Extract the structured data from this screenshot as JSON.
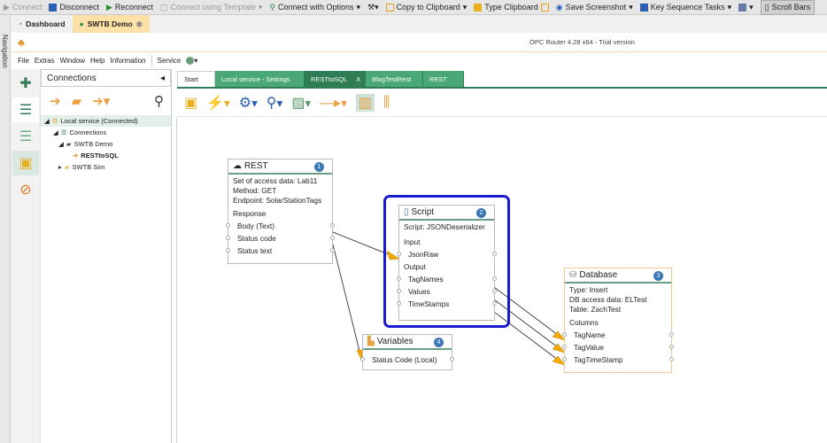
{
  "toolbar": {
    "connect": "Connect",
    "disconnect": "Disconnect",
    "reconnect": "Reconnect",
    "connect_template": "Connect using Template",
    "connect_options": "Connect with Options",
    "copy_clipboard": "Copy to Clipboard",
    "type_clipboard": "Type  Clipboard",
    "save_screenshot": "Save  Screenshot",
    "key_sequence": "Key Sequence Tasks",
    "scroll_bars": "Scroll Bars"
  },
  "session_tabs": [
    {
      "label": "Dashboard"
    },
    {
      "label": "SWTB Demo"
    }
  ],
  "navigation_label": "Navigation",
  "app_title": "OPC Router 4.28 x64 - Trial version",
  "menu": [
    "File",
    "Extras",
    "Window",
    "Help",
    "Information",
    "Service"
  ],
  "connections": {
    "title": "Connections",
    "tree": [
      "Local service (Connected)",
      "Connections",
      "SWTB Demo",
      "RESTtoSQL",
      "SWTB Sim"
    ]
  },
  "doc_tabs": [
    "Start",
    "Local service - Settings",
    "RESTtoSQL",
    "BlogTestRest",
    "REST"
  ],
  "close_tab": "X",
  "nodes": {
    "rest": {
      "title": "REST",
      "badge": "1",
      "info": [
        "Set of access data: Lab11",
        "Method: GET",
        "Endpoint: SolarStationTags"
      ],
      "section": "Response",
      "ports": [
        "Body (Text)",
        "Status code",
        "Status text"
      ]
    },
    "script": {
      "title": "Script",
      "badge": "2",
      "info": "Script: JSONDeserializer",
      "input": "Input",
      "inputs": [
        "JsonRaw"
      ],
      "output": "Output",
      "outputs": [
        "TagNames",
        "Values",
        "TimeStamps"
      ]
    },
    "variables": {
      "title": "Variables",
      "badge": "4",
      "ports": [
        "Status Code (Local)"
      ]
    },
    "database": {
      "title": "Database",
      "badge": "3",
      "info": [
        "Type: Insert",
        "DB access data: ELTest",
        "Table: ZachTest"
      ],
      "section": "Columns",
      "ports": [
        "TagName",
        "TagValue",
        "TagTimeStamp"
      ]
    }
  }
}
